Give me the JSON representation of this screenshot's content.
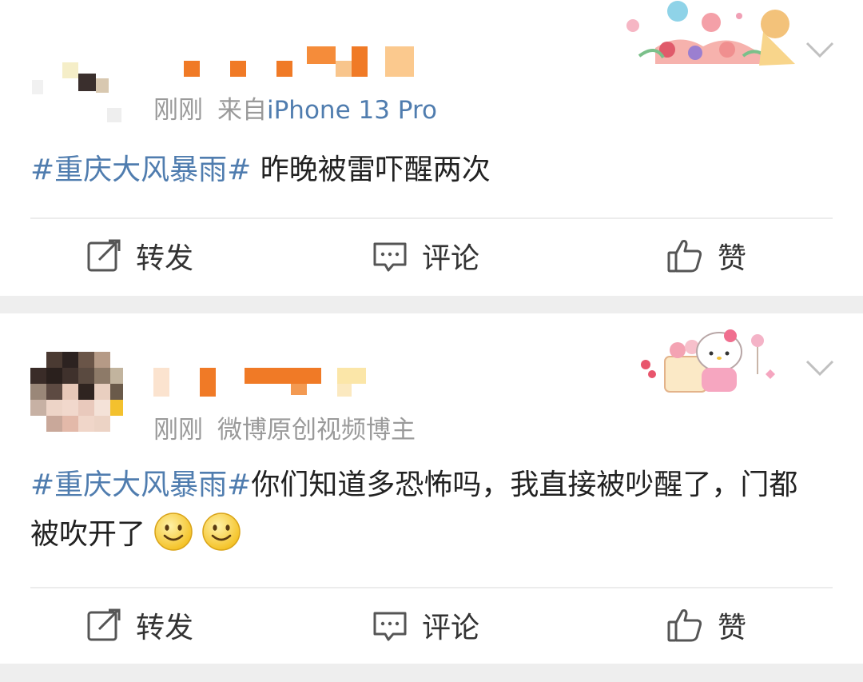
{
  "posts": [
    {
      "meta": {
        "time": "刚刚",
        "source_prefix": "来自",
        "device": "iPhone 13 Pro"
      },
      "content": {
        "topic": "#重庆大风暴雨#",
        "text": " 昨晚被雷吓醒两次"
      },
      "actions": {
        "repost": "转发",
        "comment": "评论",
        "like": "赞"
      }
    },
    {
      "meta": {
        "time": "刚刚",
        "badge": "微博原创视频博主"
      },
      "content": {
        "topic": "#重庆大风暴雨#",
        "text": "你们知道多恐怖吗，我直接被吵醒了，门都被吹开了"
      },
      "actions": {
        "repost": "转发",
        "comment": "评论",
        "like": "赞"
      }
    }
  ],
  "colors": {
    "link": "#507daf",
    "meta": "#9a9a9a",
    "name_orange": "#f07a26"
  },
  "icons": [
    "repost-icon",
    "comment-icon",
    "like-icon",
    "chevron-down-icon",
    "smile-emoji-icon"
  ]
}
